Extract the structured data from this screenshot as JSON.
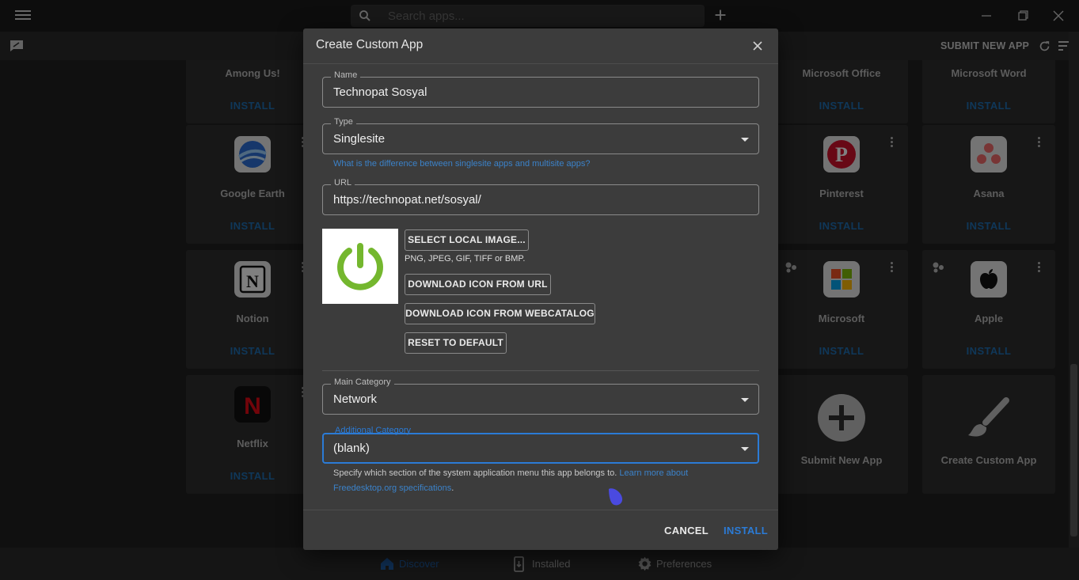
{
  "titlebar": {
    "search_placeholder": "Search apps..."
  },
  "toolbar": {
    "submit_label": "SUBMIT NEW APP"
  },
  "install_label": "INSTALL",
  "cards": [
    {
      "name": "Among Us!"
    },
    {
      "name": "Microsoft Office"
    },
    {
      "name": "Microsoft Word"
    },
    {
      "name": "Google Earth"
    },
    {
      "name": "Pinterest"
    },
    {
      "name": "Asana"
    },
    {
      "name": "Notion"
    },
    {
      "name": "Microsoft"
    },
    {
      "name": "Apple"
    },
    {
      "name": "Netflix"
    },
    {
      "name": "Submit New App"
    },
    {
      "name": "Create Custom App"
    }
  ],
  "bottom_nav": {
    "discover": "Discover",
    "installed": "Installed",
    "preferences": "Preferences"
  },
  "dialog": {
    "title": "Create Custom App",
    "name_label": "Name",
    "name_value": "Technopat Sosyal",
    "type_label": "Type",
    "type_value": "Singlesite",
    "type_help_link": "What is the difference between singlesite apps and multisite apps?",
    "url_label": "URL",
    "url_value": "https://technopat.net/sosyal/",
    "select_local_image": "SELECT LOCAL IMAGE...",
    "formats_hint": "PNG, JPEG, GIF, TIFF or BMP.",
    "download_icon_url": "DOWNLOAD ICON FROM URL",
    "download_icon_webcatalog": "DOWNLOAD ICON FROM WEBCATALOG",
    "reset_default": "RESET TO DEFAULT",
    "main_category_label": "Main Category",
    "main_category_value": "Network",
    "additional_category_label": "Additional Category",
    "additional_category_value": "(blank)",
    "category_help_text": "Specify which section of the system application menu this app belongs to. ",
    "category_help_link": "Learn more about Freedesktop.org specifications",
    "category_help_end": ".",
    "cancel": "CANCEL",
    "install": "INSTALL"
  },
  "colors": {
    "accent": "#2b7bd6",
    "install_link": "#1f6fb3",
    "icon_green": "#74b72e"
  }
}
